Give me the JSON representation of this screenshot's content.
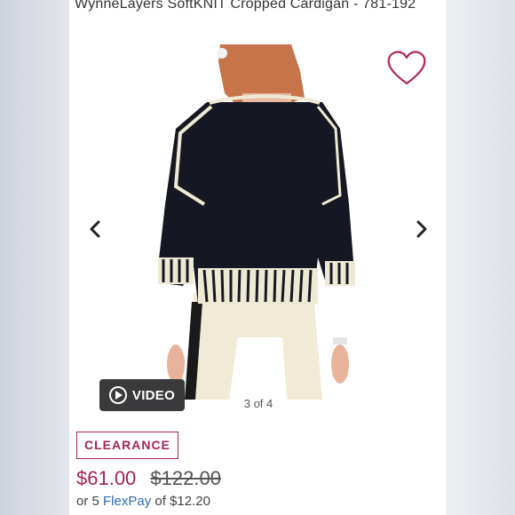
{
  "product": {
    "title": "WynneLayers SoftKNIT Cropped Cardigan - 781-192"
  },
  "gallery": {
    "counter": "3 of 4",
    "video_label": "VIDEO"
  },
  "pricing": {
    "badge": "CLEARANCE",
    "sale_price": "$61.00",
    "original_price": "$122.00",
    "flexpay_prefix": "or 5 ",
    "flexpay_link": "FlexPay",
    "flexpay_suffix": " of $12.20"
  },
  "colors": {
    "accent": "#a5225a",
    "link": "#2b6cb0"
  }
}
